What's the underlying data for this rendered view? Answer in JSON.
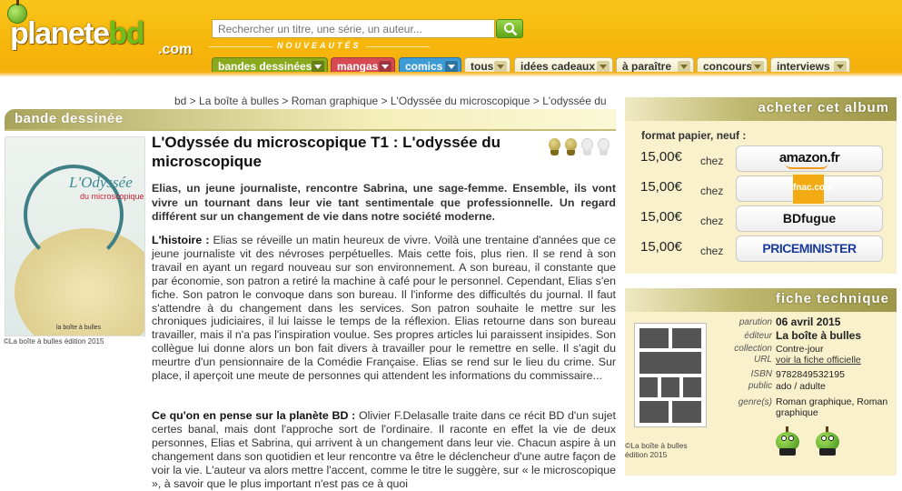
{
  "header": {
    "logo_main": "planete",
    "logo_accent": "bd",
    "logo_suffix": ".com",
    "search_placeholder": "Rechercher un titre, une série, un auteur...",
    "nouveautes_label": "NOUVEAUTÉS",
    "tabs": [
      {
        "label": "bandes dessinées",
        "color": "#8aaa1e"
      },
      {
        "label": "mangas",
        "color": "#d64a53"
      },
      {
        "label": "comics",
        "color": "#3d9bd6"
      },
      {
        "label": "tous"
      },
      {
        "label": "idées cadeaux"
      },
      {
        "label": "à paraître"
      },
      {
        "label": "concours"
      },
      {
        "label": "interviews"
      }
    ]
  },
  "breadcrumb": "bd > La boîte à bulles > Roman graphique > L'Odyssée du microscopique > L'odyssée du microscopique",
  "section_title": "bande dessinée",
  "cover": {
    "title_word": "L'Odyssée",
    "subtitle_word": "du microscopique",
    "publisher_mark": "la boîte à bulles",
    "caption": "©La boîte à bulles édition 2015"
  },
  "album": {
    "title": "L'Odyssée du microscopique T1 : L'odyssée du microscopique",
    "rating": 2,
    "rating_max": 4,
    "summary": "Elias, un jeune journaliste, rencontre Sabrina, une sage-femme. Ensemble, ils vont vivre un tournant dans leur vie tant sentimentale que professionnelle. Un regard différent sur un changement de vie dans notre société moderne.",
    "histoire_label": "L'histoire :",
    "histoire": " Elias se réveille un matin heureux de vivre. Voilà une trentaine d'années que ce jeune journaliste vit des névroses perpétuelles. Mais cette fois, plus rien. Il se rend à son travail en ayant un regard nouveau sur son environnement. A son bureau, il constante que par économie, son patron a retiré la machine à café pour le personnel. Cependant, Elias s'en fiche. Son patron le convoque dans son bureau. Il l'informe des difficultés du journal. Il faut s'attendre à du changement dans les services. Son patron souhaite le mettre sur les chroniques judiciaires, il lui laisse le temps de la réflexion. Elias retourne dans son bureau travailler, mais il n'a pas l'inspiration voulue. Ses propres articles lui paraissent insipides. Son collègue lui donne alors un bon fait divers à travailler pour le remettre en selle. Il s'agit du meurtre d'un pensionnaire de la Comédie Française. Elias se rend sur le lieu du crime. Sur place, il aperçoit une meute de personnes qui attendent les informations du commissaire...",
    "opinion_label": "Ce qu'on en pense sur la planète BD :",
    "opinion": " Olivier F.Delasalle traite dans ce récit BD d'un sujet certes banal, mais dont l'approche sort de l'ordinaire. Il raconte en effet la vie de deux personnes, Elias et Sabrina, qui arrivent à un changement dans leur vie. Chacun aspire à un changement dans son quotidien et leur rencontre va être le déclencheur d'une autre façon de voir la vie. L'auteur va alors mettre l'accent, comme le titre le suggère, sur « le microscopique », à savoir que le plus important n'est pas ce à quoi"
  },
  "buy": {
    "title": "acheter cet album",
    "format_label": "format papier, neuf :",
    "offers": [
      {
        "price": "15,00€",
        "chez": "chez",
        "shop": "amazon.fr",
        "icon": "amazon-logo"
      },
      {
        "price": "15,00€",
        "chez": "chez",
        "shop": "fnac.com",
        "icon": "fnac-logo"
      },
      {
        "price": "15,00€",
        "chez": "chez",
        "shop": "BDfugue",
        "icon": "bdfugue-logo"
      },
      {
        "price": "15,00€",
        "chez": "chez",
        "shop": "PRICEMINISTER",
        "icon": "priceminister-logo"
      }
    ]
  },
  "fiche": {
    "title": "fiche technique",
    "caption": "©La boîte à bulles édition 2015",
    "rows": [
      {
        "key": "parution",
        "value": "06 avril 2015"
      },
      {
        "key": "éditeur",
        "value": "La boîte à bulles"
      },
      {
        "key": "collection",
        "value": "Contre-jour"
      },
      {
        "key": "URL",
        "value": "voir la fiche officielle"
      },
      {
        "key": "ISBN",
        "value": "9782849532195"
      },
      {
        "key": "public",
        "value": "ado / adulte"
      },
      {
        "key": "genre(s)",
        "value": "Roman graphique, Roman graphique"
      }
    ]
  }
}
